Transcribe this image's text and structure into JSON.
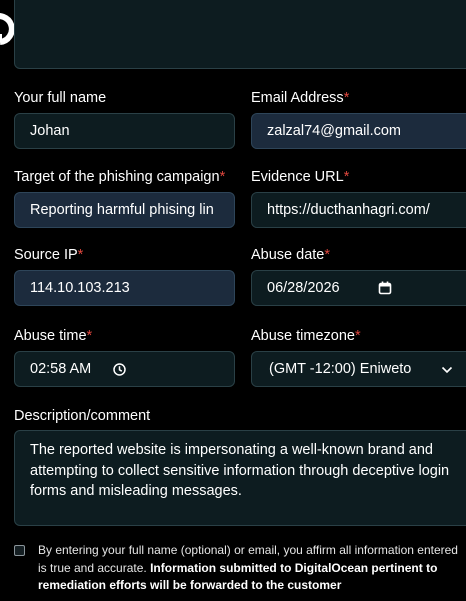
{
  "form": {
    "full_name": {
      "label": "Your full name",
      "value": "Johan"
    },
    "email": {
      "label": "Email Address",
      "required": "*",
      "value": "zalzal74@gmail.com"
    },
    "target": {
      "label": "Target of the phishing campaign",
      "required": "*",
      "value": "Reporting harmful phising lin"
    },
    "evidence_url": {
      "label": "Evidence URL",
      "required": "*",
      "value": "https://ducthanhagri.com/"
    },
    "source_ip": {
      "label": "Source IP",
      "required": "*",
      "value": "114.10.103.213"
    },
    "abuse_date": {
      "label": "Abuse date",
      "required": "*",
      "value": "06/28/2026",
      "icon": "calendar-icon"
    },
    "abuse_time": {
      "label": "Abuse time",
      "required": "*",
      "value": "02:58 AM",
      "icon": "clock-icon"
    },
    "abuse_timezone": {
      "label": "Abuse timezone",
      "required": "*",
      "value": "(GMT -12:00) Eniweto",
      "icon": "chevron-down-icon"
    },
    "description": {
      "label": "Description/comment",
      "value": "The reported website is impersonating a well-known brand and attempting to collect sensitive information through deceptive login forms and misleading messages."
    },
    "consent": {
      "text": "By entering your full name (optional) or email, you affirm all information entered is true and accurate.",
      "bold_text": "Information submitted to DigitalOcean pertinent to remediation efforts will be forwarded to the customer"
    }
  },
  "colors": {
    "background": "#000000",
    "required_star": "#e0473e",
    "field_dark": "#0d1c20",
    "field_filled": "#1c2b3d"
  }
}
